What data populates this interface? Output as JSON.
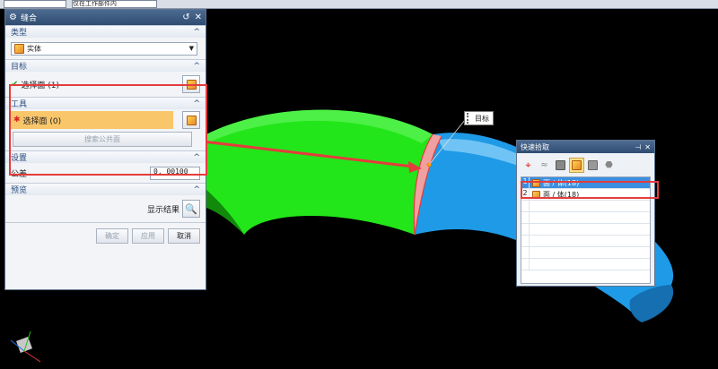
{
  "toolbar": {
    "combo1": "",
    "combo2": "仅在工作部件内"
  },
  "dialog": {
    "title": "缝合",
    "type_group": {
      "label": "类型",
      "value": "实体"
    },
    "target_group": {
      "label": "目标",
      "select": "选择面 (1)"
    },
    "tool_group": {
      "label": "工具",
      "select": "选择面 (0)",
      "search": "搜索公共面"
    },
    "settings_group": {
      "label": "设置",
      "tol_label": "公差",
      "tol_value": "0. 00100"
    },
    "preview_group": {
      "label": "预览",
      "show_result": "显示结果"
    },
    "buttons": {
      "ok": "确定",
      "apply": "应用",
      "cancel": "取消"
    }
  },
  "pick_dialog": {
    "title": "快速拾取",
    "rows": [
      {
        "num": "1",
        "text": "面 / 体(18)"
      },
      {
        "num": "2",
        "text": "面 / 体(18)"
      }
    ]
  },
  "callout": {
    "text": "目标"
  },
  "colors": {
    "green": "#22e61a",
    "blue": "#1f9ae6",
    "annotation_red": "#e43c3c",
    "title_blue": "#2f4c72"
  }
}
